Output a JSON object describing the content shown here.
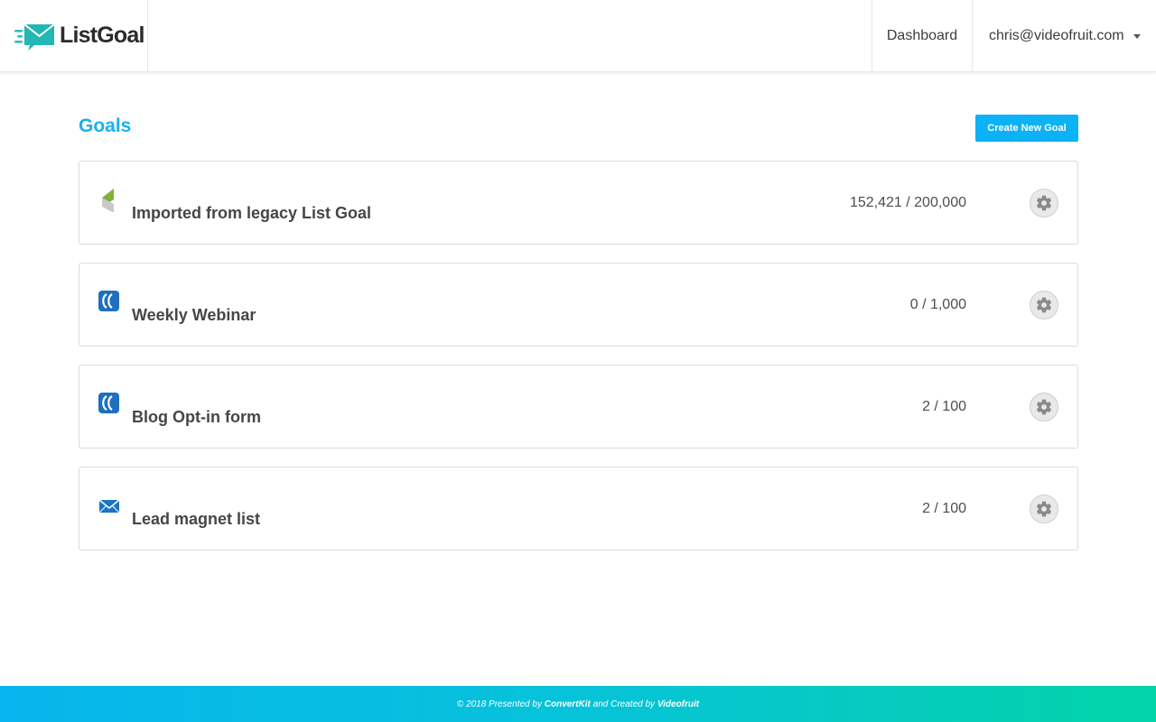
{
  "app": {
    "logo_text": "ListGoal",
    "brand_color": "#18b7c7",
    "accent_color": "#0bb2f6"
  },
  "nav": {
    "dashboard_label": "Dashboard",
    "user_email": "chris@videofruit.com"
  },
  "main": {
    "title": "Goals",
    "create_button_label": "Create New Goal",
    "goals": [
      {
        "name": "Imported from legacy List Goal",
        "progress": "152,421 / 200,000",
        "icon": "legacy-listgoal-icon"
      },
      {
        "name": "Weekly Webinar",
        "progress": "0 / 1,000",
        "icon": "convertkit-icon"
      },
      {
        "name": "Blog Opt-in form",
        "progress": "2 / 100",
        "icon": "convertkit-icon"
      },
      {
        "name": "Lead magnet list",
        "progress": "2 / 100",
        "icon": "envelope-icon"
      }
    ]
  },
  "footer": {
    "prefix": "© 2018 Presented by",
    "presenter": "ConvertKit",
    "middle": "and Created by",
    "creator": "Videofruit"
  }
}
